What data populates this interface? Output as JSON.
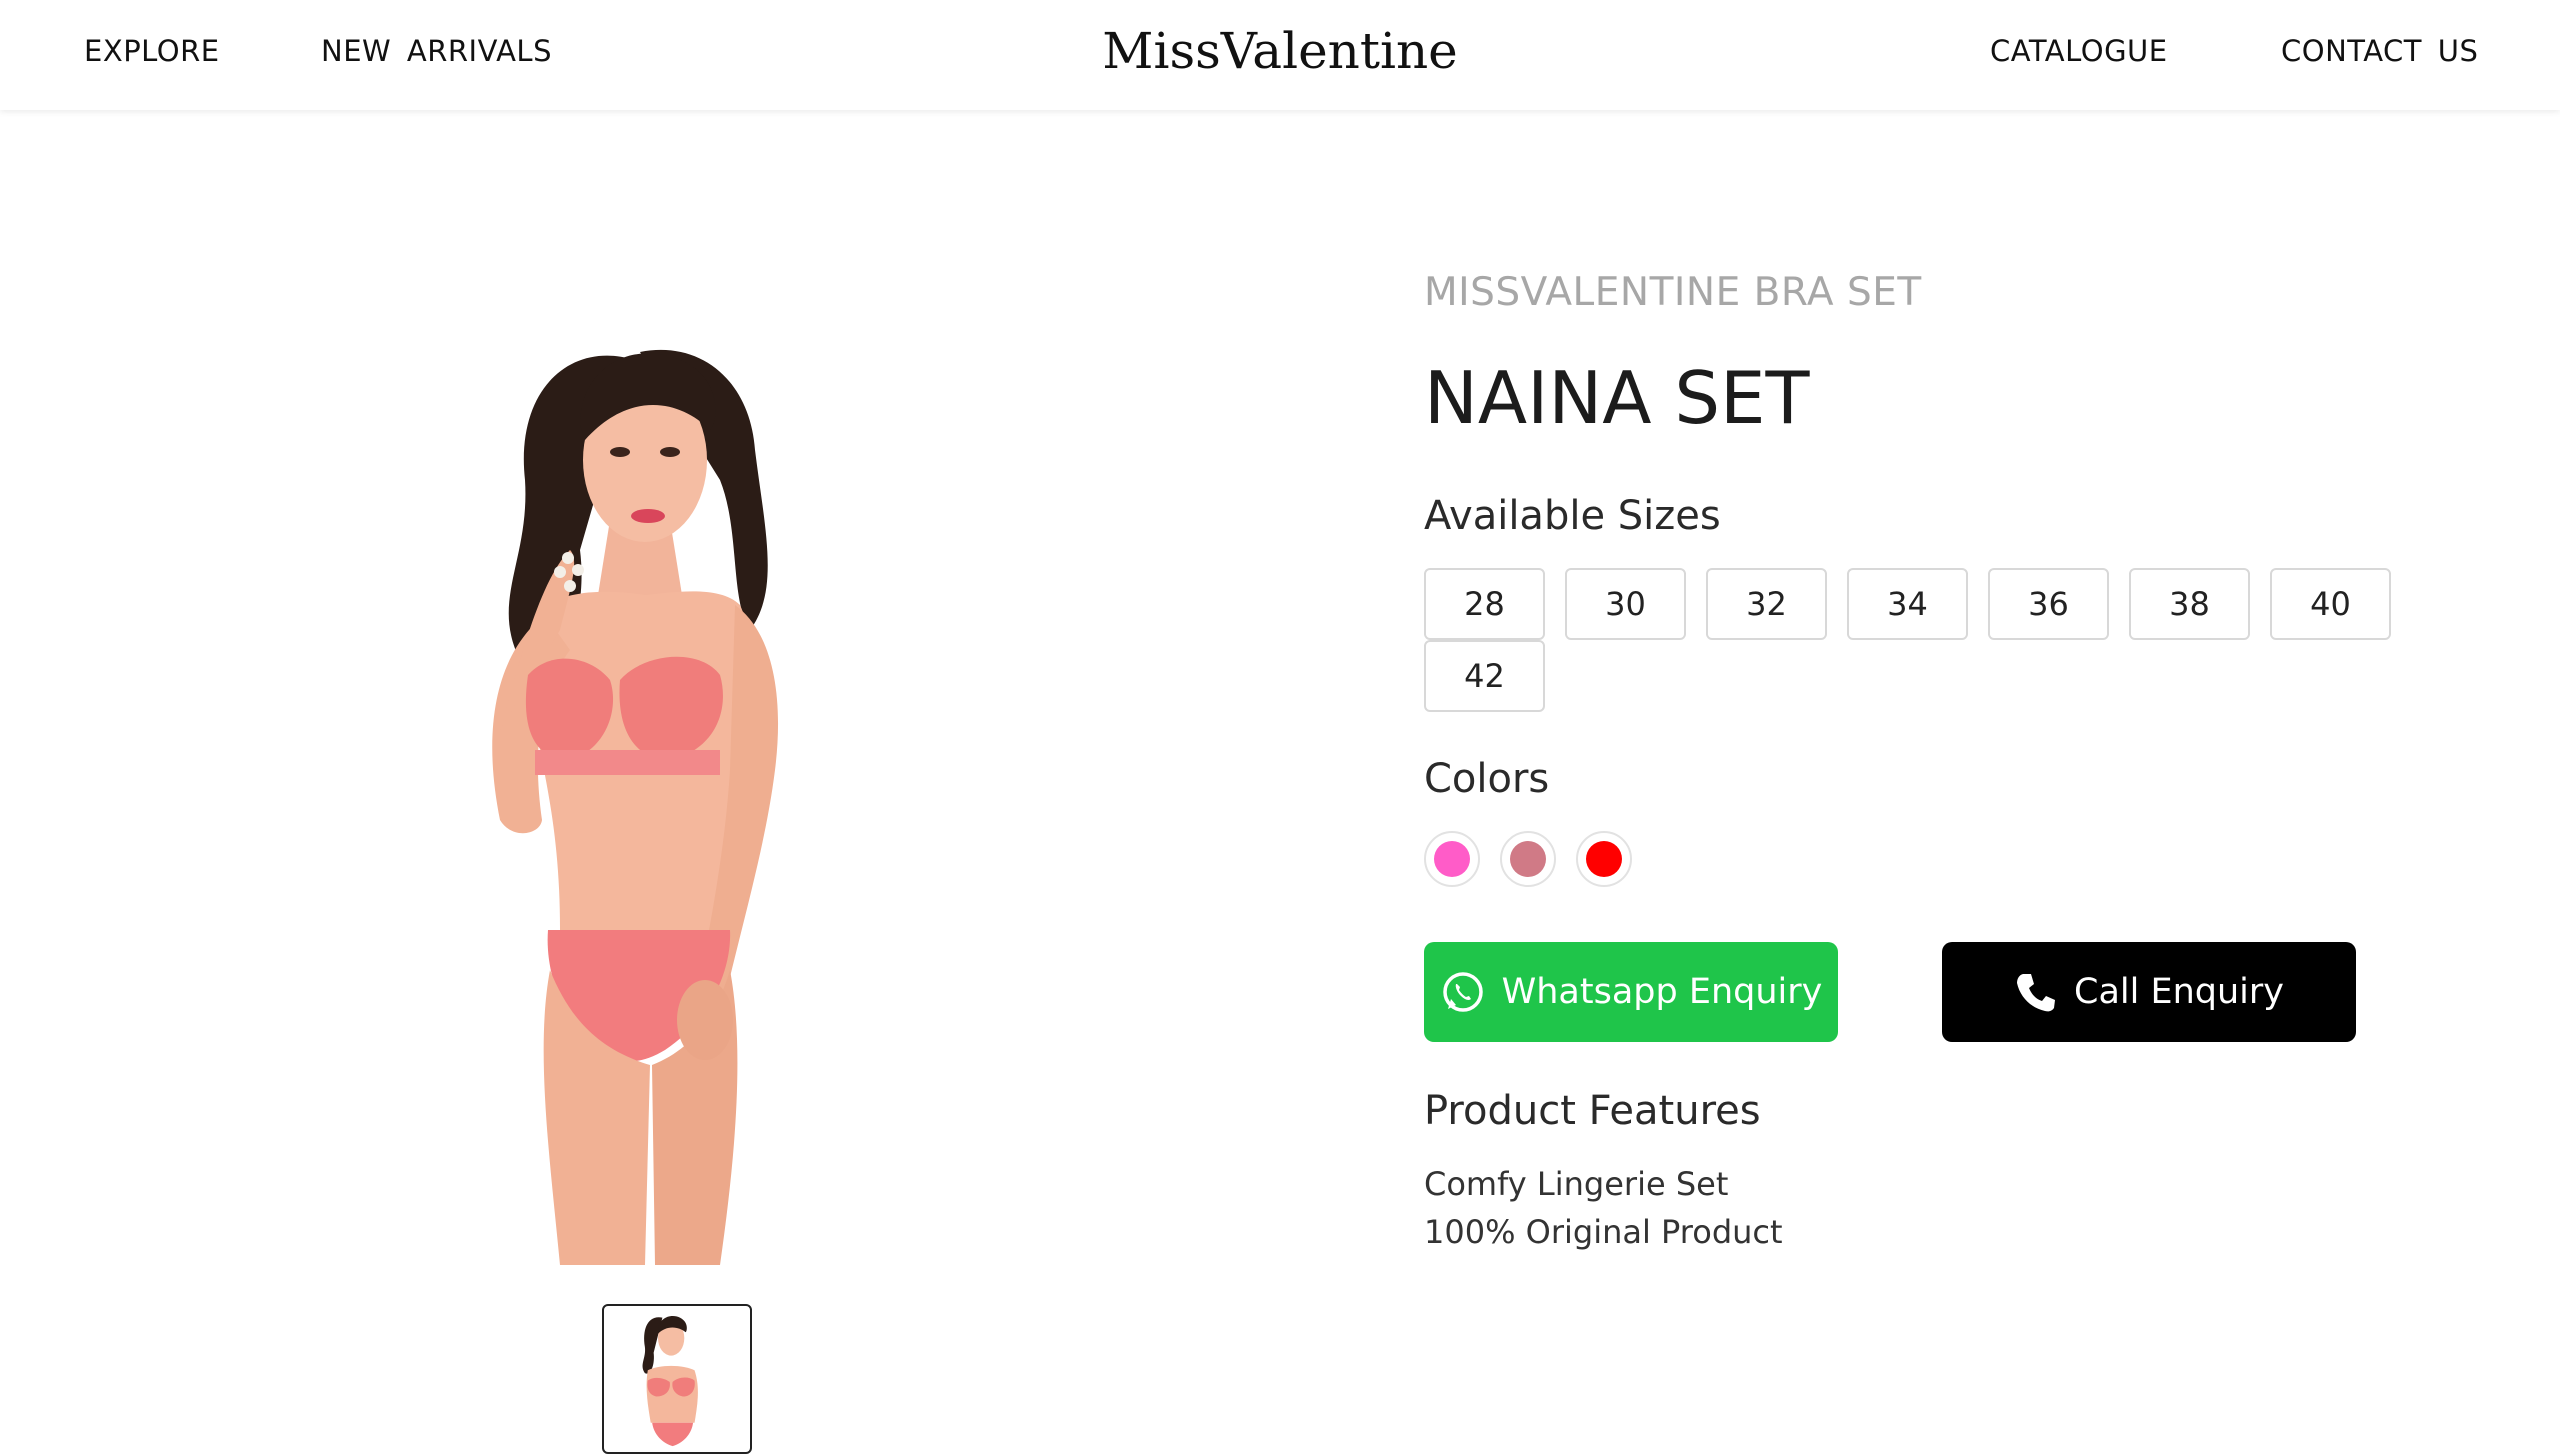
{
  "header": {
    "nav_left": [
      "EXPLORE",
      "NEW  ARRIVALS"
    ],
    "brand": "MissValentine",
    "nav_right": [
      "CATALOGUE",
      "CONTACT  US"
    ]
  },
  "product": {
    "brand_line": "MISSVALENTINE BRA SET",
    "title": "NAINA SET",
    "sizes_heading": "Available Sizes",
    "sizes": [
      "28",
      "30",
      "32",
      "34",
      "36",
      "38",
      "40",
      "42"
    ],
    "colors_heading": "Colors",
    "colors": [
      "#ff5cc8",
      "#d07a86",
      "#ff0000"
    ],
    "buttons": {
      "whatsapp": "Whatsapp Enquiry",
      "call": "Call Enquiry"
    },
    "features_heading": "Product Features",
    "features": [
      "Comfy Lingerie Set",
      "100% Original Product"
    ]
  },
  "images": {
    "main_image": "product-photo-model",
    "thumbnail": "product-thumbnail"
  }
}
